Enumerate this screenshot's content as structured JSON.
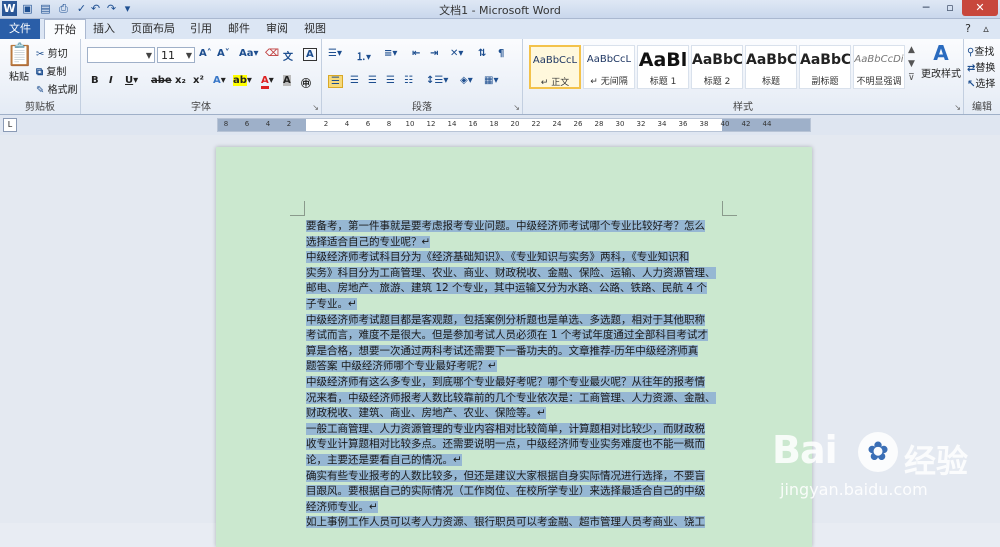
{
  "window": {
    "title": "文档1 - Microsoft Word"
  },
  "tabs": [
    "文件",
    "开始",
    "插入",
    "页面布局",
    "引用",
    "邮件",
    "审阅",
    "视图"
  ],
  "clipboard": {
    "paste": "粘贴",
    "cut": "剪切",
    "copy": "复制",
    "format_painter": "格式刷",
    "group": "剪贴板"
  },
  "font": {
    "name": "",
    "size": "11",
    "group": "字体"
  },
  "paragraph": {
    "group": "段落"
  },
  "styles": {
    "group": "样式",
    "items": [
      {
        "sample": "AaBbCcL",
        "name": "↵ 正文"
      },
      {
        "sample": "AaBbCcL",
        "name": "↵ 无间隔"
      },
      {
        "sample": "AaBl",
        "name": "标题 1"
      },
      {
        "sample": "AaBbC",
        "name": "标题 2"
      },
      {
        "sample": "AaBbC",
        "name": "标题"
      },
      {
        "sample": "AaBbC",
        "name": "副标题"
      },
      {
        "sample": "AaBbCcDi",
        "name": "不明显强调"
      }
    ],
    "change": "更改样式"
  },
  "editing": {
    "find": "查找",
    "replace": "替换",
    "select": "选择",
    "group": "编辑"
  },
  "ruler": [
    "8",
    "6",
    "4",
    "2",
    "2",
    "4",
    "6",
    "8",
    "10",
    "12",
    "14",
    "16",
    "18",
    "20",
    "22",
    "24",
    "26",
    "28",
    "30",
    "32",
    "34",
    "36",
    "38",
    "40",
    "42",
    "44"
  ],
  "document": {
    "lines": [
      "要备考，第一件事就是要考虑报考专业问题。中级经济师考试哪个专业比较好考？怎么",
      "选择适合自己的专业呢？↵",
      "中级经济师考试科目分为《经济基础知识》、《专业知识与实务》两科，《专业知识和",
      "实务》科目分为工商管理、农业、商业、财政税收、金融、保险、运输、人力资源管理、",
      "邮电、房地产、旅游、建筑 12 个专业，其中运输又分为水路、公路、铁路、民航 4 个",
      "子专业。↵",
      "中级经济师考试题目都是客观题，包括案例分析题也是单选、多选题，相对于其他职称",
      "考试而言，难度不是很大。但是参加考试人员必须在 1 个考试年度通过全部科目考试才",
      "算是合格，想要一次通过两科考试还需要下一番功夫的。文章推荐-历年中级经济师真",
      "题答案   中级经济师哪个专业最好考呢？↵",
      "中级经济师有这么多专业，到底哪个专业最好考呢？哪个专业最火呢？从往年的报考情",
      "况来看，中级经济师报考人数比较靠前的几个专业依次是：工商管理、人力资源、金融、",
      "财政税收、建筑、商业、房地产、农业、保险等。↵",
      "一般工商管理、人力资源管理的专业内容相对比较简单，计算题相对比较少，而财政税",
      "收专业计算题相对比较多点。还需要说明一点，中级经济师专业实务难度也不能一概而",
      "论，主要还是要看自己的情况。↵",
      "确实有些专业报考的人数比较多，但还是建议大家根据自身实际情况进行选择，不要盲",
      "目跟风。要根据自己的实际情况（工作岗位、在校所学专业）来选择最适合自己的中级",
      "经济师专业。↵",
      "如上事例工作人员可以考人力资源、银行职员可以考金融、超市管理人员考商业、饶工"
    ]
  },
  "watermark": {
    "brand": "Bai",
    "brand_cn": "经验",
    "url": "jingyan.baidu.com"
  },
  "colors": {
    "page": "#cbe8cf",
    "selection": "#96b7d3",
    "file_tab": "#2a5ea8"
  }
}
